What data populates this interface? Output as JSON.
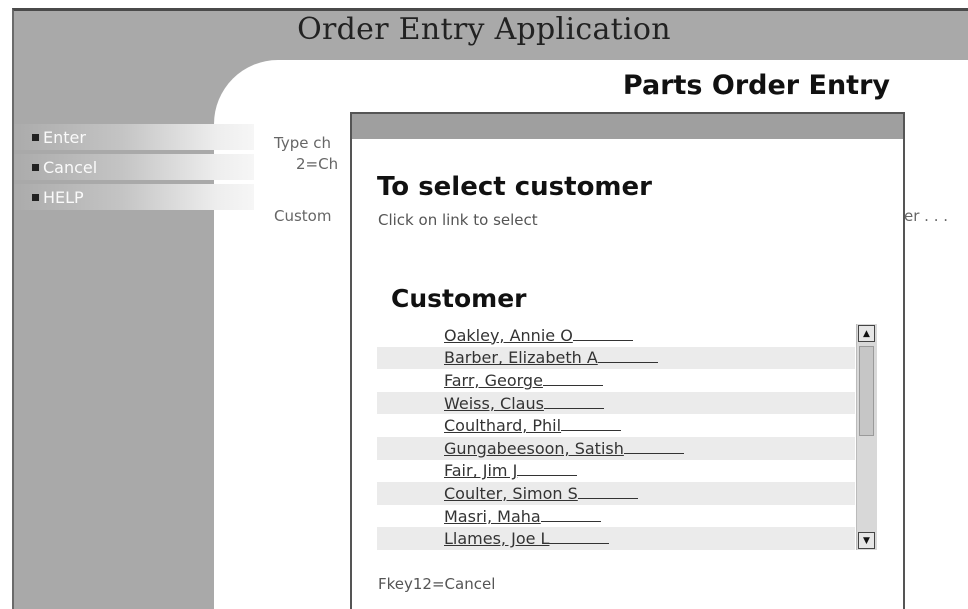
{
  "app": {
    "title": "Order Entry Application"
  },
  "page": {
    "title": "Parts Order Entry"
  },
  "fkeys": [
    {
      "label": "Enter"
    },
    {
      "label": "Cancel"
    },
    {
      "label": "HELP"
    }
  ],
  "background": {
    "instruction_line1": "Type ch",
    "instruction_line2": "2=Ch",
    "customer_label": "Custom",
    "right_fragment": "er  . . ."
  },
  "dialog": {
    "heading": "To select customer",
    "subtext": "Click on link to select",
    "list_heading": "Customer",
    "customers": [
      "Oakley, Annie O",
      "Barber, Elizabeth A",
      "Farr, George",
      "Weiss, Claus",
      "Coulthard, Phil",
      "Gungabeesoon, Satish",
      "Fair, Jim J",
      "Coulter, Simon S",
      "Masri, Maha",
      "Llames, Joe L"
    ],
    "footer": "Fkey12=Cancel"
  },
  "icons": {
    "fkey_bullet": "square-bullet-icon",
    "scroll_up": "triangle-up-icon",
    "scroll_down": "triangle-down-icon"
  }
}
